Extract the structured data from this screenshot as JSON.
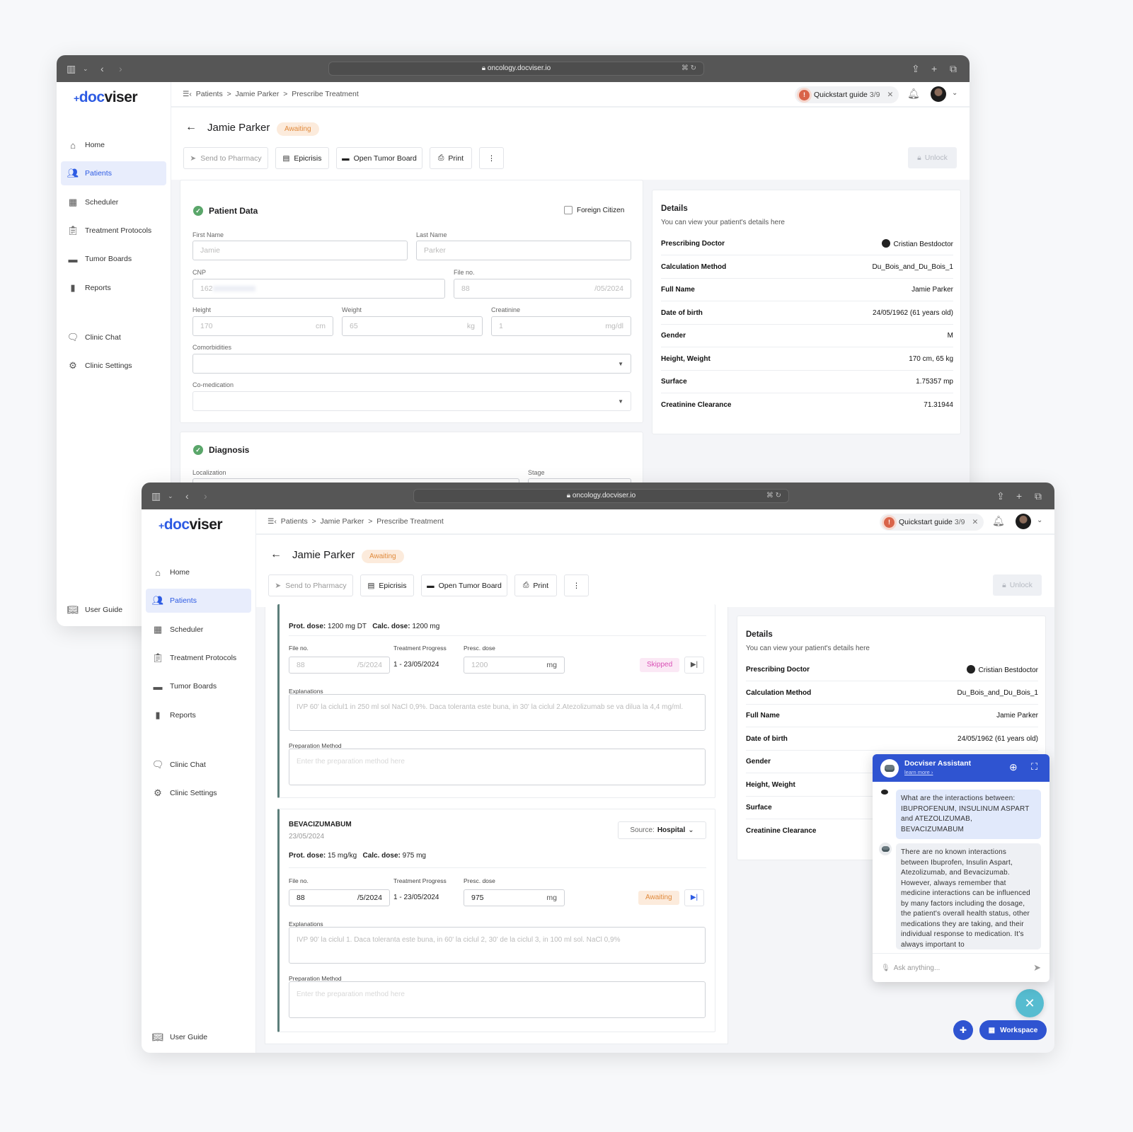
{
  "browser": {
    "url": "oncology.docviser.io",
    "icons": [
      "sidebar-icon",
      "chevron-down-icon",
      "back-icon",
      "forward-icon",
      "lock-icon",
      "translate-icon",
      "reload-icon",
      "share-icon",
      "new-tab-icon",
      "tabs-icon"
    ]
  },
  "app": {
    "logo_plus": "+",
    "logo_doc": "doc",
    "logo_viser": "viser"
  },
  "sidebar": {
    "items": [
      {
        "label": "Home",
        "icon": "home-icon"
      },
      {
        "label": "Patients",
        "icon": "users-icon",
        "active": true
      },
      {
        "label": "Scheduler",
        "icon": "calendar-icon"
      },
      {
        "label": "Treatment Protocols",
        "icon": "clipboard-icon"
      },
      {
        "label": "Tumor Boards",
        "icon": "folder-user-icon"
      },
      {
        "label": "Reports",
        "icon": "bar-chart-icon"
      },
      {
        "label": "Clinic Chat",
        "icon": "chat-icon"
      },
      {
        "label": "Clinic Settings",
        "icon": "gear-icon"
      },
      {
        "label": "User Guide",
        "icon": "book-icon"
      }
    ]
  },
  "header": {
    "breadcrumb": [
      "Patients",
      "Jamie Parker",
      "Prescribe Treatment"
    ],
    "sep": ">",
    "quickstart_label": "Quickstart guide",
    "quickstart_progress": "3/9"
  },
  "patient": {
    "name": "Jamie Parker",
    "status": "Awaiting",
    "status_color": "#e08a3c"
  },
  "actions": {
    "send": "Send to Pharmacy",
    "epicrisis": "Epicrisis",
    "tumor_board": "Open Tumor Board",
    "print": "Print",
    "unlock": "Unlock"
  },
  "patient_data": {
    "title": "Patient Data",
    "foreign_citizen": "Foreign Citizen",
    "foreign_citizen_checked": false,
    "first_name_label": "First Name",
    "first_name": "Jamie",
    "last_name_label": "Last Name",
    "last_name": "Parker",
    "cnp_label": "CNP",
    "cnp": "162",
    "file_label": "File no.",
    "file_no": "88",
    "file_suffix": "/05/2024",
    "height_label": "Height",
    "height": "170",
    "height_unit": "cm",
    "weight_label": "Weight",
    "weight": "65",
    "weight_unit": "kg",
    "creatinine_label": "Creatinine",
    "creatinine": "1",
    "creatinine_unit": "mg/dl",
    "comorbidities_label": "Comorbidities",
    "comedication_label": "Co-medication"
  },
  "diagnosis": {
    "title": "Diagnosis",
    "localization_label": "Localization",
    "stage_label": "Stage"
  },
  "details": {
    "title": "Details",
    "subtitle": "You can view your patient's details here",
    "rows": [
      {
        "k": "Prescribing Doctor",
        "v": "Cristian Bestdoctor"
      },
      {
        "k": "Calculation Method",
        "v": "Du_Bois_and_Du_Bois_1"
      },
      {
        "k": "Full Name",
        "v": "Jamie Parker"
      },
      {
        "k": "Date of birth",
        "v": "24/05/1962 (61 years old)"
      },
      {
        "k": "Gender",
        "v": "M"
      },
      {
        "k": "Height, Weight",
        "v": "170 cm, 65 kg"
      },
      {
        "k": "Surface",
        "v": "1.75357 mp"
      },
      {
        "k": "Creatinine Clearance",
        "v": "71.31944"
      }
    ]
  },
  "drugs": [
    {
      "prot_label": "Prot. dose:",
      "prot": "1200 mg DT",
      "calc_label": "Calc. dose:",
      "calc": "1200 mg",
      "file_label": "File no.",
      "file_no": "88",
      "file_suffix": "/5/2024",
      "progress_label": "Treatment Progress",
      "progress": "1 - 23/05/2024",
      "presc_label": "Presc. dose",
      "presc": "1200",
      "unit": "mg",
      "status": "Skipped",
      "status_color": "#d94fb5",
      "expl_label": "Explanations",
      "explanation": "IVP 60' la ciclul1 in 250 ml sol NaCl 0,9%. Daca toleranta este buna, in 30' la ciclul 2.Atezolizumab se va dilua la 4,4 mg/ml.",
      "prep_label": "Preparation Method",
      "prep_placeholder": "Enter the preparation method here"
    },
    {
      "name": "BEVACIZUMABUM",
      "date": "23/05/2024",
      "source_label": "Source:",
      "source": "Hospital",
      "prot_label": "Prot. dose:",
      "prot": "15 mg/kg",
      "calc_label": "Calc. dose:",
      "calc": "975 mg",
      "file_label": "File no.",
      "file_no": "88",
      "file_suffix": "/5/2024",
      "progress_label": "Treatment Progress",
      "progress": "1 - 23/05/2024",
      "presc_label": "Presc. dose",
      "presc": "975",
      "unit": "mg",
      "status": "Awaiting",
      "status_color": "#e08a3c",
      "expl_label": "Explanations",
      "explanation": "IVP 90' la ciclul 1. Daca toleranta este buna, in 60' la ciclul 2, 30' de la ciclul 3, in 100 ml sol. NaCl 0,9%",
      "prep_label": "Preparation Method",
      "prep_placeholder": "Enter the preparation method here"
    }
  ],
  "assistant": {
    "title": "Docviser Assistant",
    "learn_more": "learn more ›",
    "question": "What are the interactions between: IBUPROFENUM, INSULINUM ASPART and  ATEZOLIZUMAB, BEVACIZUMABUM",
    "answer": "There are no known interactions between Ibuprofen, Insulin Aspart, Atezolizumab, and Bevacizumab. However, always remember that medicine interactions can be influenced by many factors including the dosage, the patient's overall health status, other medications they are taking, and their individual response to medication. It's always important to",
    "input_placeholder": "Ask anything...",
    "header_color": "#2f54d1"
  },
  "fab": {
    "workspace": "Workspace",
    "close_color": "#56bcd0"
  }
}
